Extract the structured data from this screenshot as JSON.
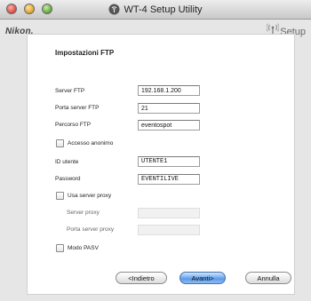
{
  "window": {
    "title": "WT-4 Setup Utility"
  },
  "header": {
    "brand": "Nikon.",
    "setup_label": "Setup"
  },
  "panel": {
    "title": "Impostazioni FTP",
    "server_ftp": {
      "label": "Server FTP",
      "value": "192.168.1.200"
    },
    "porta_server_ftp": {
      "label": "Porta server FTP",
      "value": "21"
    },
    "percorso_ftp": {
      "label": "Percorso FTP",
      "value": "eventospot"
    },
    "accesso_anonimo": {
      "label": "Accesso anonimo",
      "checked": false
    },
    "id_utente": {
      "label": "ID utente",
      "value": "UTENTE1"
    },
    "password": {
      "label": "Password",
      "value": "EVENTILIVE"
    },
    "usa_server_proxy": {
      "label": "Usa server proxy",
      "checked": false
    },
    "server_proxy": {
      "label": "Server proxy",
      "value": ""
    },
    "porta_server_proxy": {
      "label": "Porta server proxy",
      "value": ""
    },
    "modo_pasv": {
      "label": "Modo PASV",
      "checked": false
    }
  },
  "buttons": {
    "back": "<Indietro",
    "next": "Avanti>",
    "cancel": "Annulla"
  }
}
